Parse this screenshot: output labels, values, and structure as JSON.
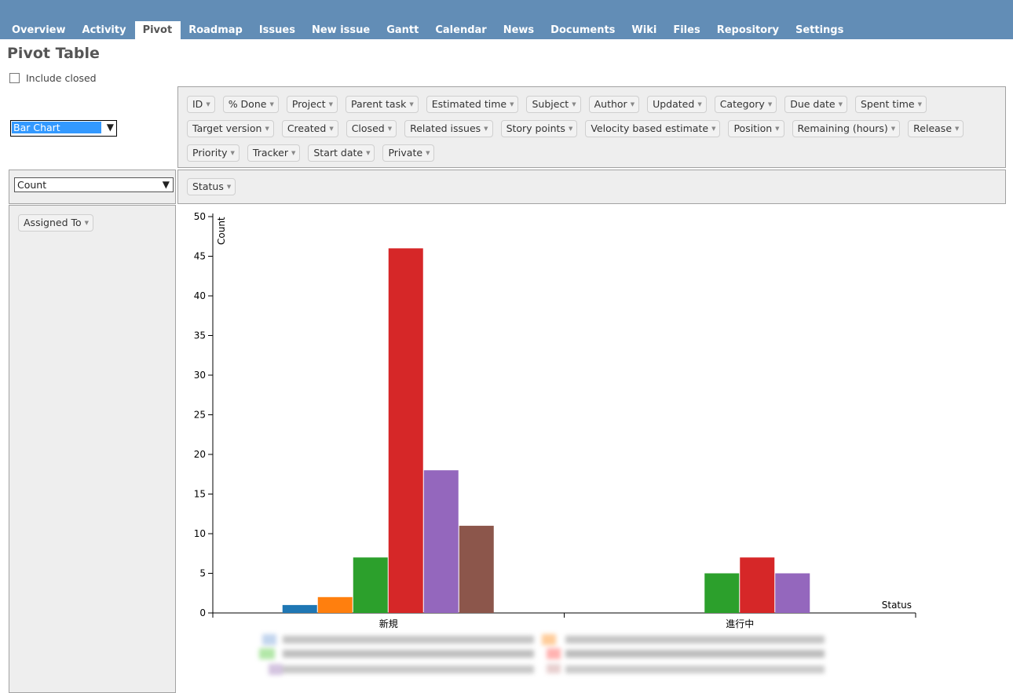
{
  "nav": {
    "tabs": [
      "Overview",
      "Activity",
      "Pivot",
      "Roadmap",
      "Issues",
      "New issue",
      "Gantt",
      "Calendar",
      "News",
      "Documents",
      "Wiki",
      "Files",
      "Repository",
      "Settings"
    ],
    "selected": "Pivot"
  },
  "page_title": "Pivot Table",
  "include_closed": {
    "label": "Include closed",
    "checked": false
  },
  "renderer": {
    "selected": "Bar Chart"
  },
  "aggregator": {
    "selected": "Count"
  },
  "attributes": [
    [
      "ID",
      "% Done",
      "Project",
      "Parent task",
      "Estimated time",
      "Subject",
      "Author",
      "Updated",
      "Category",
      "Due date",
      "Spent time"
    ],
    [
      "Target version",
      "Created",
      "Closed",
      "Related issues",
      "Story points",
      "Velocity based estimate",
      "Position",
      "Remaining (hours)",
      "Release"
    ],
    [
      "Priority",
      "Tracker",
      "Start date",
      "Private"
    ]
  ],
  "columns_attr": "Status",
  "rows_attr": "Assigned To",
  "colors": {
    "nav_bg": "#628db6",
    "series": [
      "#1f77b4",
      "#ff7f0e",
      "#2ca02c",
      "#d62728",
      "#9467bd",
      "#8c564b"
    ]
  },
  "chart_data": {
    "type": "bar",
    "categories": [
      "新規",
      "進行中"
    ],
    "series": [
      {
        "values": [
          1,
          0
        ]
      },
      {
        "values": [
          2,
          0
        ]
      },
      {
        "values": [
          7,
          5
        ]
      },
      {
        "values": [
          46,
          7
        ]
      },
      {
        "values": [
          18,
          5
        ]
      },
      {
        "values": [
          11,
          0
        ]
      }
    ],
    "xlabel": "Status",
    "ylabel": "Count",
    "ylim": [
      0,
      50
    ],
    "yticks": [
      0,
      5,
      10,
      15,
      20,
      25,
      30,
      35,
      40,
      45,
      50
    ],
    "grid": false
  }
}
